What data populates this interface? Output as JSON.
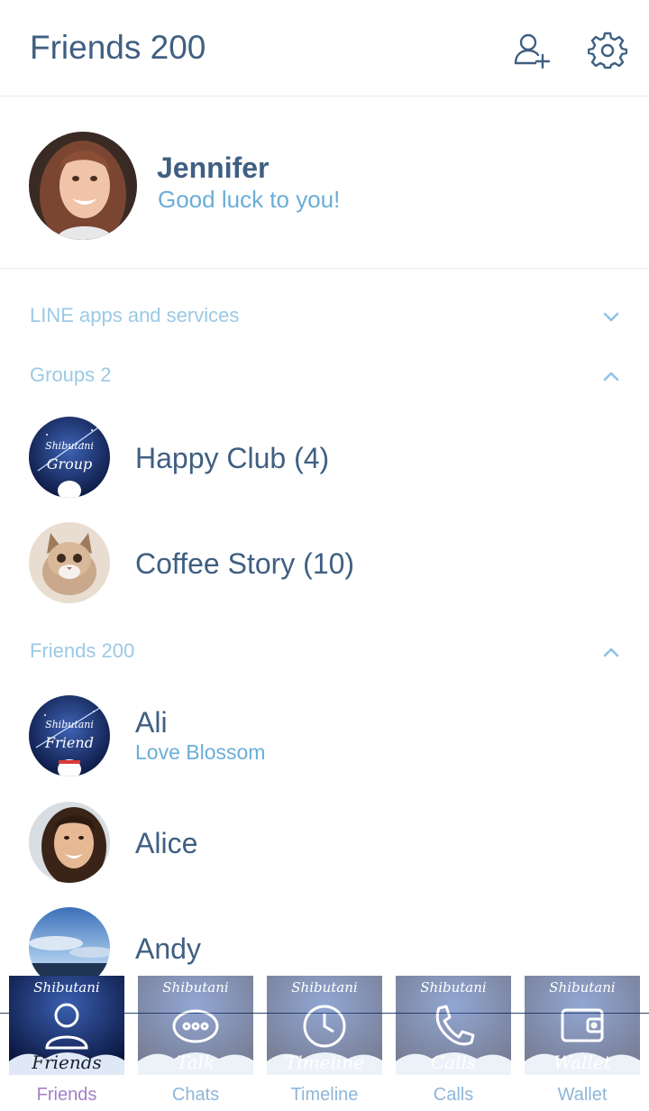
{
  "header": {
    "title": "Friends 200"
  },
  "profile": {
    "name": "Jennifer",
    "status": "Good luck to you!"
  },
  "sections": {
    "apps": "LINE apps and services",
    "groups": "Groups 2",
    "friends": "Friends 200"
  },
  "groups": [
    {
      "name": "Happy Club (4)",
      "avatar_text": "Shibutani",
      "avatar_caption": "Group"
    },
    {
      "name": "Coffee Story (10)"
    }
  ],
  "friends": [
    {
      "name": "Ali",
      "status": "Love Blossom",
      "avatar_text": "Shibutani",
      "avatar_caption": "Friend"
    },
    {
      "name": "Alice",
      "status": ""
    },
    {
      "name": "Andy",
      "status": ""
    }
  ],
  "tabs": [
    {
      "label": "Friends",
      "brand": "Shibutani",
      "caption": "Friends",
      "active": true
    },
    {
      "label": "Chats",
      "brand": "Shibutani",
      "caption": "Talk"
    },
    {
      "label": "Timeline",
      "brand": "Shibutani",
      "caption": "Timeline"
    },
    {
      "label": "Calls",
      "brand": "Shibutani",
      "caption": "Calls"
    },
    {
      "label": "Wallet",
      "brand": "Shibutani",
      "caption": "Wallet"
    }
  ],
  "colors": {
    "title": "#3f5f82",
    "accent_text": "#6aaed6",
    "section_label": "#9bc9e5",
    "active_tab": "#a680c8"
  }
}
